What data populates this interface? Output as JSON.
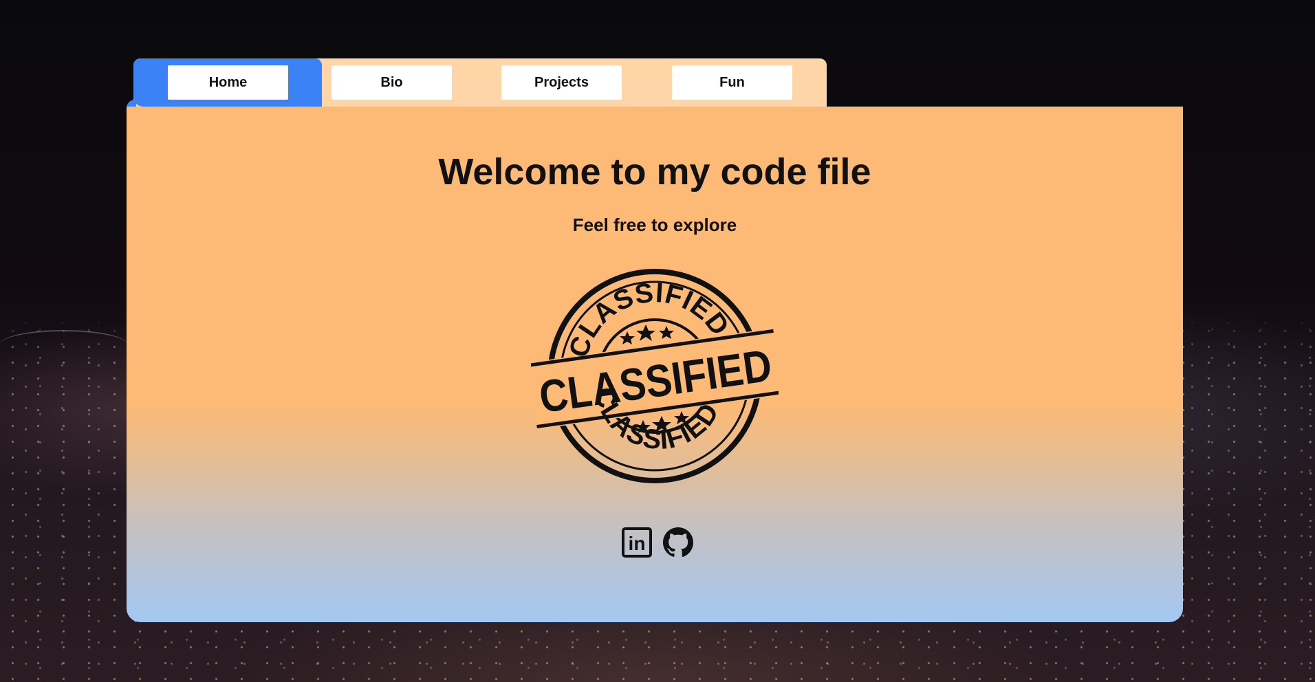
{
  "nav": {
    "tabs": [
      {
        "label": "Home",
        "active": true
      },
      {
        "label": "Bio",
        "active": false
      },
      {
        "label": "Projects",
        "active": false
      },
      {
        "label": "Fun",
        "active": false
      }
    ]
  },
  "main": {
    "title": "Welcome to my code file",
    "subtitle": "Feel free to explore",
    "stamp": {
      "icon": "classified-stamp-icon",
      "top_text": "CLASSIFIED",
      "center_text": "CLASSIFIED",
      "bottom_text": "CLASSIFIED"
    }
  },
  "social": [
    {
      "icon": "linkedin-icon",
      "label": "in"
    },
    {
      "icon": "github-icon"
    }
  ],
  "colors": {
    "active_tab": "#3b82f6",
    "tab_strip": "#fdd5a6",
    "card_top": "#fcba76",
    "card_bottom": "#a4c8f2",
    "background": "#0a0a0c"
  }
}
